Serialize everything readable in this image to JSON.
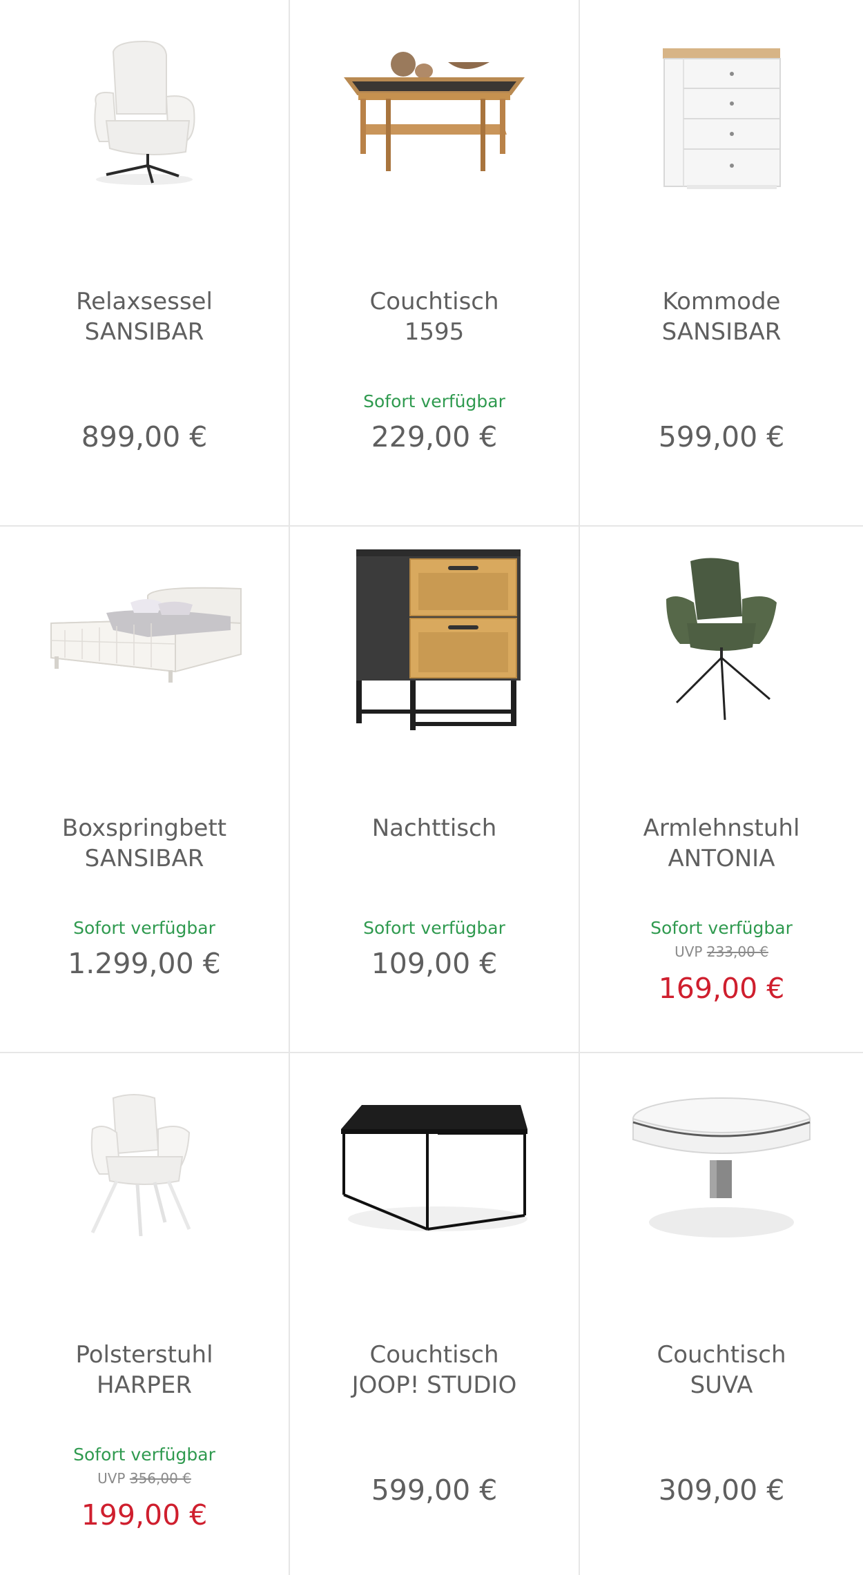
{
  "products": [
    {
      "name_line1": "Relaxsessel",
      "name_line2": "SANSIBAR",
      "availability": "",
      "price": "899,00 €",
      "uvp_label": "",
      "uvp_price": "",
      "sale_price": "",
      "image_icon": "armchair-icon"
    },
    {
      "name_line1": "Couchtisch",
      "name_line2": "1595",
      "availability": "Sofort verfügbar",
      "price": "229,00 €",
      "uvp_label": "",
      "uvp_price": "",
      "sale_price": "",
      "image_icon": "coffee-table-icon"
    },
    {
      "name_line1": "Kommode",
      "name_line2": "SANSIBAR",
      "availability": "",
      "price": "599,00 €",
      "uvp_label": "",
      "uvp_price": "",
      "sale_price": "",
      "image_icon": "dresser-icon"
    },
    {
      "name_line1": "Boxspringbett",
      "name_line2": "SANSIBAR",
      "availability": "Sofort verfügbar",
      "price": "1.299,00 €",
      "uvp_label": "",
      "uvp_price": "",
      "sale_price": "",
      "image_icon": "bed-icon"
    },
    {
      "name_line1": "Nachttisch",
      "name_line2": "",
      "availability": "Sofort verfügbar",
      "price": "109,00 €",
      "uvp_label": "",
      "uvp_price": "",
      "sale_price": "",
      "image_icon": "nightstand-icon"
    },
    {
      "name_line1": "Armlehnstuhl",
      "name_line2": "ANTONIA",
      "availability": "Sofort verfügbar",
      "price": "",
      "uvp_label": "UVP",
      "uvp_price": "233,00 €",
      "sale_price": "169,00 €",
      "image_icon": "armchair-green-icon"
    },
    {
      "name_line1": "Polsterstuhl",
      "name_line2": "HARPER",
      "availability": "Sofort verfügbar",
      "price": "",
      "uvp_label": "UVP",
      "uvp_price": "356,00 €",
      "sale_price": "199,00 €",
      "image_icon": "dining-chair-icon"
    },
    {
      "name_line1": "Couchtisch",
      "name_line2": "JOOP! STUDIO",
      "availability": "",
      "price": "599,00 €",
      "uvp_label": "",
      "uvp_price": "",
      "sale_price": "",
      "image_icon": "metal-coffee-table-icon"
    },
    {
      "name_line1": "Couchtisch",
      "name_line2": "SUVA",
      "availability": "",
      "price": "309,00 €",
      "uvp_label": "",
      "uvp_price": "",
      "sale_price": "",
      "image_icon": "round-coffee-table-icon"
    }
  ],
  "colors": {
    "availability": "#2f9a4f",
    "sale_price": "#cf1f2e",
    "text": "#5f5f5f",
    "divider": "#e6e6e6"
  }
}
